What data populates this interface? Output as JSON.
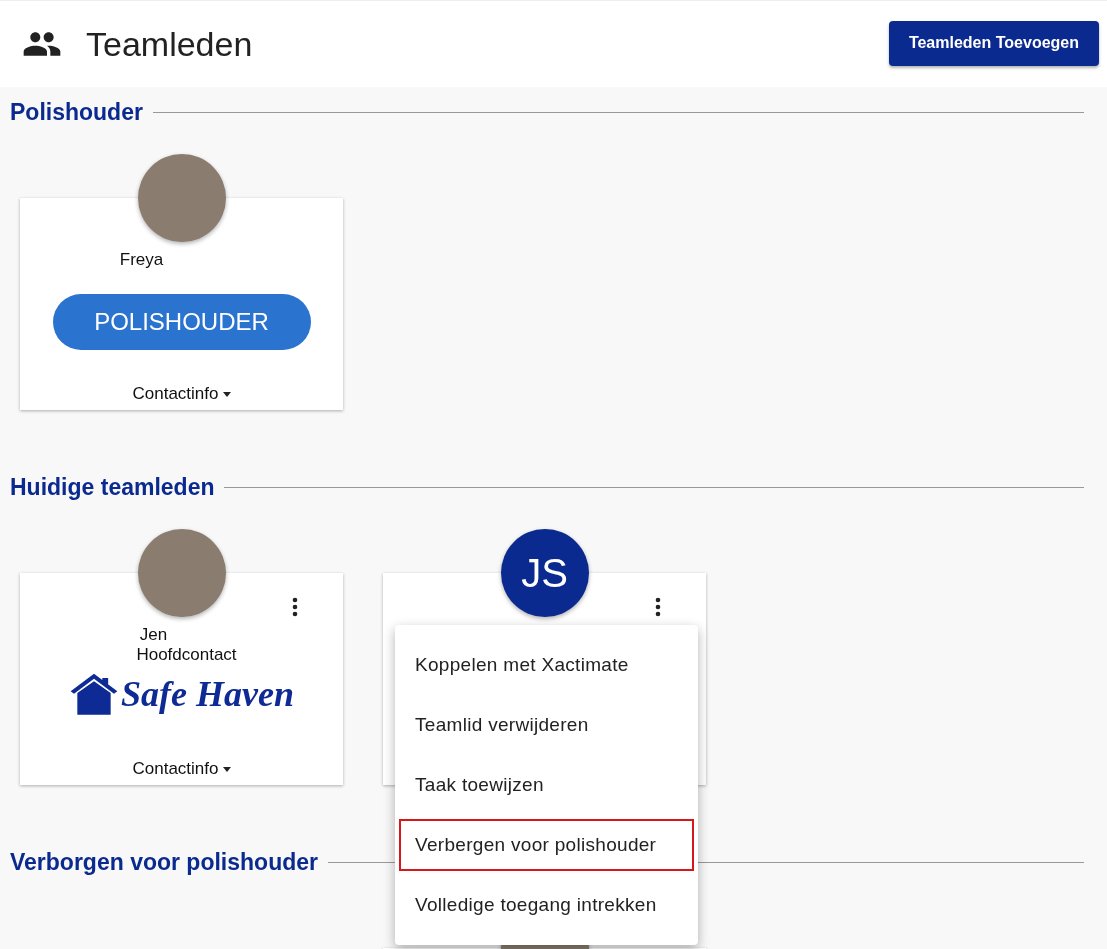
{
  "header": {
    "title": "Teamleden",
    "add_button": "Teamleden Toevoegen"
  },
  "sections": [
    {
      "title": "Polishouder",
      "cards": [
        {
          "avatar": {
            "kind": "photo"
          },
          "name": "Freya",
          "badge": "POLISHOUDER",
          "contact": "Contactinfo",
          "has_menu": false,
          "menu_open": false
        }
      ]
    },
    {
      "title": "Huidige teamleden",
      "cards": [
        {
          "avatar": {
            "kind": "photo"
          },
          "name": "Jen",
          "role": "Hoofdcontact",
          "logo": "Safe Haven",
          "contact": "Contactinfo",
          "has_menu": true,
          "menu_open": false
        },
        {
          "avatar": {
            "kind": "initials",
            "initials": "JS"
          },
          "has_menu": true,
          "menu_open": true
        }
      ]
    },
    {
      "title": "Verborgen voor polishouder",
      "cards": [
        {
          "avatar": {
            "kind": "photo"
          },
          "offset": true
        }
      ]
    }
  ],
  "menu": {
    "items": [
      {
        "label": "Koppelen met Xactimate",
        "highlighted": false
      },
      {
        "label": "Teamlid verwijderen",
        "highlighted": false
      },
      {
        "label": "Taak toewijzen",
        "highlighted": false
      },
      {
        "label": "Verbergen voor polishouder",
        "highlighted": true
      },
      {
        "label": "Volledige toegang intrekken",
        "highlighted": false
      }
    ]
  }
}
